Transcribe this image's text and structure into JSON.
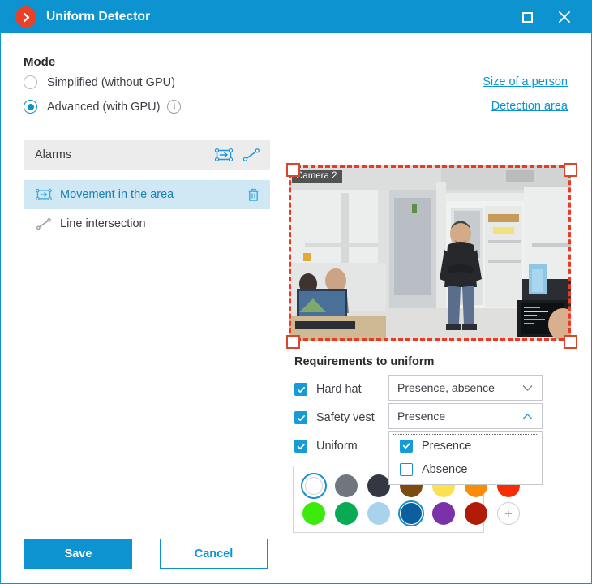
{
  "window": {
    "title": "Uniform Detector",
    "logo_icon": "chevron-right-logo-icon",
    "accent_color": "#0c93d0",
    "logo_color": "#e8412a",
    "maximize_icon": "maximize-icon",
    "close_icon": "close-icon",
    "close_glyph": "✕"
  },
  "mode": {
    "heading": "Mode",
    "options": [
      {
        "label": "Simplified (without GPU)",
        "selected": false
      },
      {
        "label": "Advanced (with GPU)",
        "selected": true,
        "info_icon": "info-icon",
        "info_glyph": "i"
      }
    ]
  },
  "links": [
    {
      "label": "Size of a person",
      "name": "size-of-a-person-link"
    },
    {
      "label": "Detection area",
      "name": "detection-area-link"
    }
  ],
  "alarms": {
    "header_title": "Alarms",
    "tools": [
      {
        "name": "add-area-icon",
        "icon": "rectangle-arrow-icon"
      },
      {
        "name": "add-line-icon",
        "icon": "line-icon"
      }
    ],
    "items": [
      {
        "label": "Movement in the area",
        "icon": "rectangle-arrow-icon",
        "selected": true,
        "delete_icon": "trash-icon"
      },
      {
        "label": "Line intersection",
        "icon": "line-icon",
        "selected": false
      }
    ]
  },
  "video": {
    "camera_label": "Camera 2",
    "detection_rect_color": "#ea3a23",
    "handles": [
      "top-left",
      "top-right",
      "bottom-left",
      "bottom-right"
    ]
  },
  "requirements": {
    "heading": "Requirements to uniform",
    "rows": [
      {
        "label": "Hard hat",
        "checked": true,
        "select_value": "Presence, absence",
        "caret": "chevron-down-icon"
      },
      {
        "label": "Safety vest",
        "checked": true,
        "select_value": "Presence",
        "caret": "chevron-up-icon"
      },
      {
        "label": "Uniform",
        "checked": true
      }
    ],
    "dropdown": {
      "options": [
        {
          "label": "Presence",
          "checked": true,
          "focused": true
        },
        {
          "label": "Absence",
          "checked": false,
          "focused": false
        }
      ]
    }
  },
  "palette": {
    "add_glyph": "+",
    "swatches": [
      {
        "name": "white",
        "color": "#ffffff",
        "selected": true
      },
      {
        "name": "gray",
        "color": "#70757e",
        "selected": false
      },
      {
        "name": "charcoal",
        "color": "#343842",
        "selected": false
      },
      {
        "name": "brown",
        "color": "#7d4a10",
        "selected": false
      },
      {
        "name": "yellow",
        "color": "#fbe051",
        "selected": false
      },
      {
        "name": "orange",
        "color": "#fb8c08",
        "selected": false
      },
      {
        "name": "red",
        "color": "#f72d05",
        "selected": false
      },
      {
        "name": "bright-green",
        "color": "#3ceb0b",
        "selected": false
      },
      {
        "name": "green",
        "color": "#07ab54",
        "selected": false
      },
      {
        "name": "light-blue",
        "color": "#a9d3ec",
        "selected": false
      },
      {
        "name": "blue",
        "color": "#0b5f9e",
        "selected": true
      },
      {
        "name": "purple",
        "color": "#7b32a8",
        "selected": false
      },
      {
        "name": "dark-red",
        "color": "#b01c06",
        "selected": false
      }
    ]
  },
  "footer": {
    "save_label": "Save",
    "cancel_label": "Cancel"
  }
}
